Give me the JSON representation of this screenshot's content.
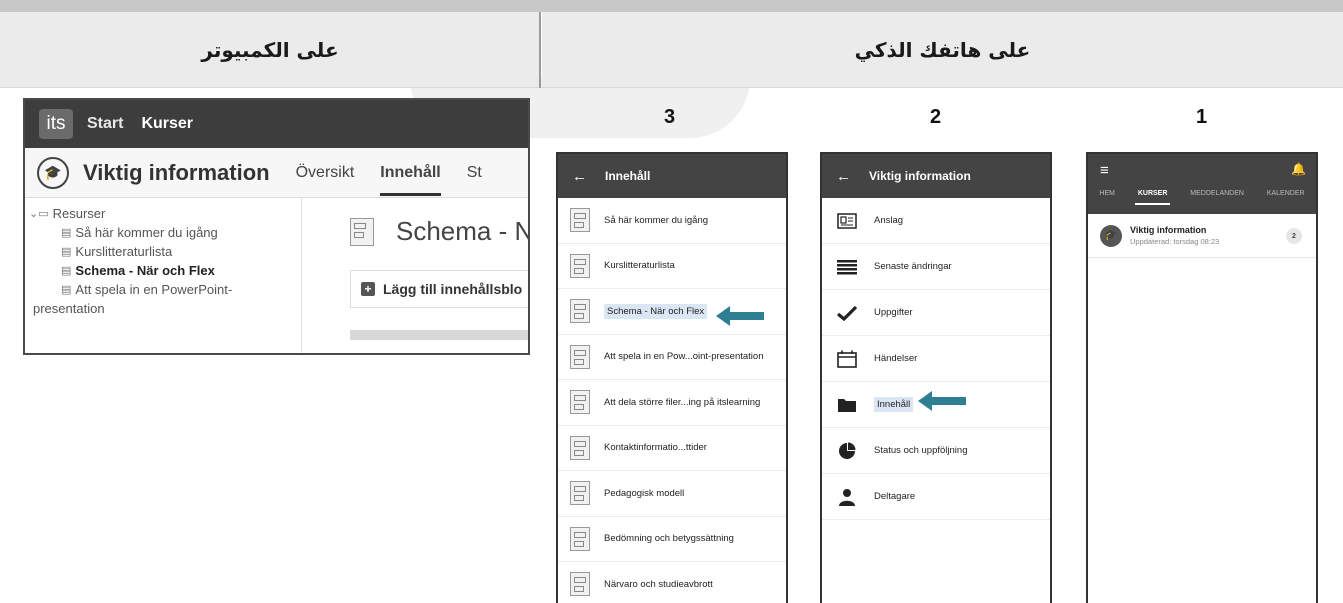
{
  "header": {
    "left_label": "على الكمبيوتر",
    "right_label": "على هاتفك الذكي"
  },
  "accent_color": "#2f7f92",
  "desktop": {
    "logo": "its",
    "nav": [
      "Start",
      "Kurser"
    ],
    "course_icon": "graduation-cap-icon",
    "course_title": "Viktig information",
    "tabs": [
      "Översikt",
      "Innehåll",
      "St"
    ],
    "tree_root": "Resurser",
    "tree_items": [
      "Så här kommer du igång",
      "Kurslitteraturlista",
      "Schema - När och Flex",
      "Att spela in en PowerPoint-"
    ],
    "tree_wrap": "presentation",
    "page_heading": "Schema - Nä",
    "add_button": "Lägg till innehållsblo"
  },
  "steps": {
    "s1": "1",
    "s2": "2",
    "s3": "3"
  },
  "phone1": {
    "tabs": [
      "HEM",
      "KURSER",
      "MEDDELANDEN",
      "KALENDER"
    ],
    "course_title": "Viktig information",
    "updated": "Uppdaterad: torsdag 08:23",
    "badge": "2"
  },
  "phone2": {
    "title": "Viktig information",
    "items": [
      "Anslag",
      "Senaste ändringar",
      "Uppgifter",
      "Händelser",
      "Innehåll",
      "Status och uppföljning",
      "Deltagare"
    ]
  },
  "phone3": {
    "title": "Innehåll",
    "items": [
      "Så här kommer du igång",
      "Kurslitteraturlista",
      "Schema - När och Flex",
      "Att spela in en Pow...oint-presentation",
      "Att dela större filer...ing på itslearning",
      "Kontaktinformatio...ttider",
      "Pedagogisk modell",
      "Bedömning och betygssättning",
      "Närvaro och studieavbrott"
    ]
  }
}
